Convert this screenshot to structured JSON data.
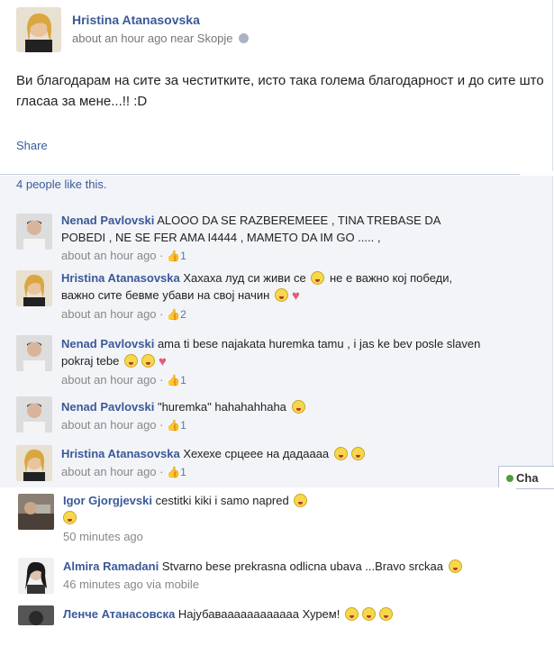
{
  "post": {
    "author": "Hristina Atanasovska",
    "meta": "about an hour ago near Skopje",
    "text": "Ви благодарам на сите за честитките, исто така голема благодарност и до сите што гласаа за мене...!! :D",
    "share_label": "Share",
    "likes": "4 people like this."
  },
  "comments": [
    {
      "name": "Nenad Pavlovski",
      "text": "ALOOO DA SE RAZBEREMEEE , TINA TREBASE DA POBEDI , NE SE FER AMA I4444 , MAMETO DA IM GO ..... ,",
      "time": "about an hour ago",
      "likes": "1"
    },
    {
      "name": "Hristina Atanasovska",
      "text": "Хахаха луд си живи се",
      "text2": "не е важно кој победи, важно сите бевме убави на свој начин",
      "time": "about an hour ago",
      "likes": "2"
    },
    {
      "name": "Nenad Pavlovski",
      "text": "ama ti bese najakata huremka tamu , i jas ke bev posle slaven pokraj tebe",
      "time": "about an hour ago",
      "likes": "1"
    },
    {
      "name": "Nenad Pavlovski",
      "text": "\"huremka\" hahahahhaha",
      "time": "about an hour ago",
      "likes": "1"
    },
    {
      "name": "Hristina Atanasovska",
      "text": "Хехехе срцеее на дадаааа",
      "time": "about an hour ago",
      "likes": "1"
    },
    {
      "name": "Igor Gjorgjevski",
      "text": "cestitki kiki i samo napred",
      "time": "50 minutes ago"
    },
    {
      "name": "Almira Ramadani",
      "text": "Stvarno bese prekrasna odlicna ubava ...Bravo srckaa",
      "time": "46 minutes ago via mobile"
    },
    {
      "name": "Ленче Атанасовска",
      "text": "Најубаваааааааааааа Хурем!"
    }
  ],
  "chat_label": "Cha",
  "colors": {
    "link": "#3b5998",
    "comment_bg": "#f2f4f8"
  }
}
